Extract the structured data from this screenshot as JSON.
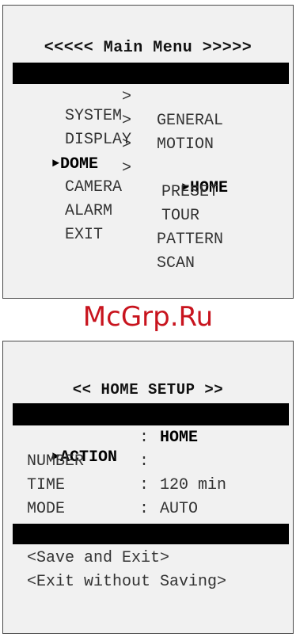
{
  "main_menu": {
    "title": "<<<<< Main Menu >>>>>",
    "cursor": "►",
    "left_items": [
      {
        "label": "SYSTEM",
        "chevron": ">"
      },
      {
        "label": "DISPLAY",
        "chevron": ">"
      },
      {
        "label": "DOME",
        "chevron": ">"
      },
      {
        "label": "CAMERA",
        "chevron": ">"
      },
      {
        "label": "ALARM",
        "chevron": ""
      },
      {
        "label": "EXIT",
        "chevron": ""
      }
    ],
    "dome_submenu": [
      "GENERAL",
      "MOTION",
      "HOME",
      "PRESET",
      "TOUR",
      "PATTERN",
      "SCAN"
    ]
  },
  "watermark": "McGrp.Ru",
  "home_setup": {
    "title": "<< HOME SETUP >>",
    "cursor": "►",
    "fields": [
      {
        "label": "ACTION",
        "sep": ":",
        "value": "HOME"
      },
      {
        "label": "NUMBER",
        "sep": ":",
        "value": ""
      },
      {
        "label": "TIME",
        "sep": ":",
        "value": "120 min"
      },
      {
        "label": "MODE",
        "sep": ":",
        "value": "AUTO"
      }
    ],
    "actions": [
      "<Save and Exit>",
      "<Exit without Saving>"
    ]
  },
  "colors": {
    "panel_bg": "#f1f1f1",
    "bar": "#000000",
    "watermark": "#c8141e"
  }
}
